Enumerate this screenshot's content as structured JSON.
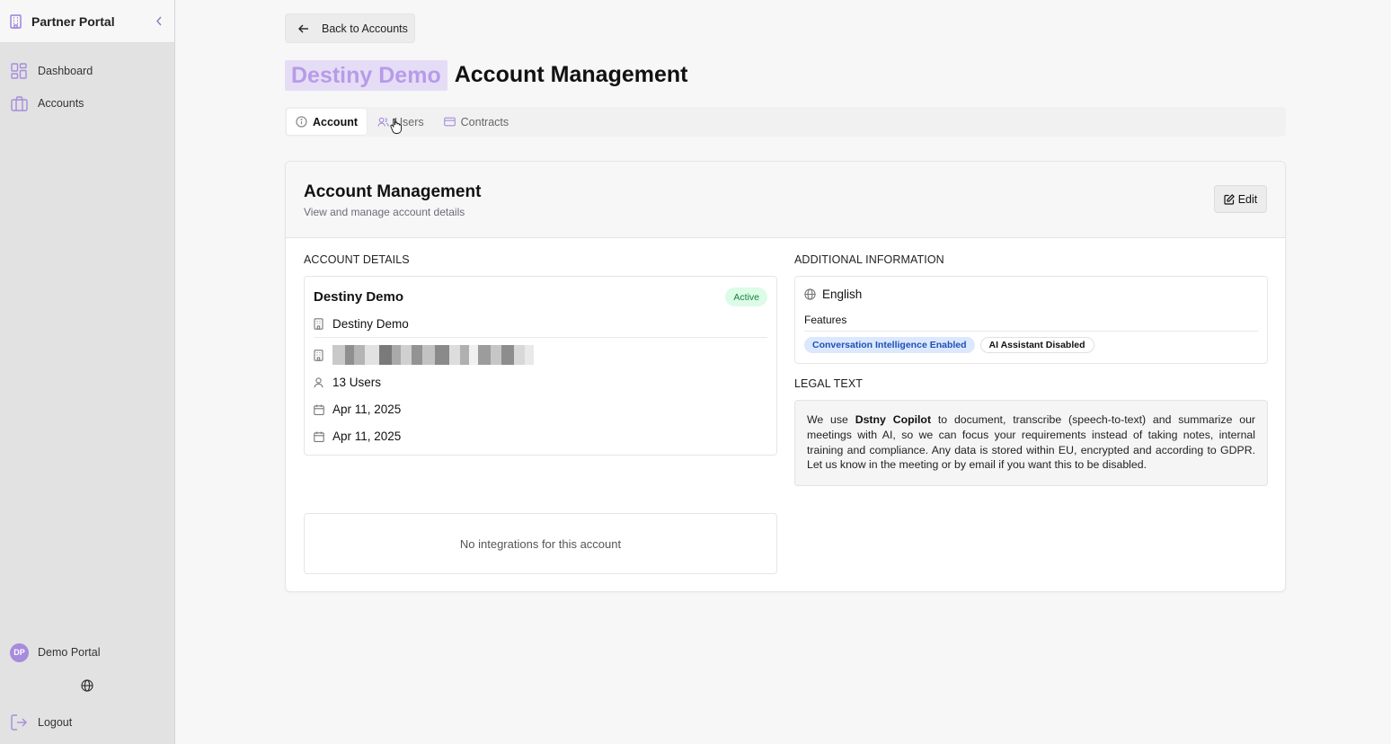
{
  "sidebar": {
    "title": "Partner Portal",
    "items": [
      {
        "label": "Dashboard",
        "icon": "dashboard-icon"
      },
      {
        "label": "Accounts",
        "icon": "briefcase-icon"
      }
    ],
    "user": {
      "initials": "DP",
      "name": "Demo Portal"
    },
    "logout_label": "Logout"
  },
  "header": {
    "back_label": "Back to Accounts",
    "brand": "Destiny Demo",
    "title": "Account Management"
  },
  "tabs": [
    {
      "label": "Account",
      "active": true,
      "icon": "info-icon"
    },
    {
      "label": "Users",
      "active": false,
      "icon": "users-icon"
    },
    {
      "label": "Contracts",
      "active": false,
      "icon": "credit-card-icon"
    }
  ],
  "card": {
    "title": "Account Management",
    "subtitle": "View and manage account details",
    "edit_label": "Edit",
    "details_label": "ACCOUNT DETAILS",
    "additional_label": "ADDITIONAL INFORMATION",
    "legal_label": "LEGAL TEXT"
  },
  "account": {
    "name": "Destiny Demo",
    "status": "Active",
    "company": "Destiny Demo",
    "users": "13 Users",
    "created": "Apr 11, 2025",
    "updated": "Apr 11, 2025"
  },
  "integrations": {
    "empty_text": "No integrations for this account"
  },
  "additional": {
    "language": "English",
    "features_label": "Features",
    "features": [
      {
        "label": "Conversation Intelligence Enabled",
        "enabled": true
      },
      {
        "label": "AI Assistant Disabled",
        "enabled": false
      }
    ]
  },
  "legal": {
    "prefix": "We use ",
    "product": "Dstny Copilot",
    "body": " to document, transcribe (speech-to-text) and summarize our meetings with AI, so we can focus your requirements instead of taking notes, internal training and compliance. Any data is stored within EU, encrypted and according to GDPR. Let us know in the meeting or by email if you want this to be disabled."
  },
  "colors": {
    "accent": "#a48ed8",
    "brand_highlight_bg": "#e5ddf6",
    "brand_highlight_text": "#b79be8",
    "active_badge_bg": "#dcfce7",
    "active_badge_text": "#16803d",
    "feature_on_bg": "#dbe8fd",
    "feature_on_text": "#1f4fb8"
  }
}
